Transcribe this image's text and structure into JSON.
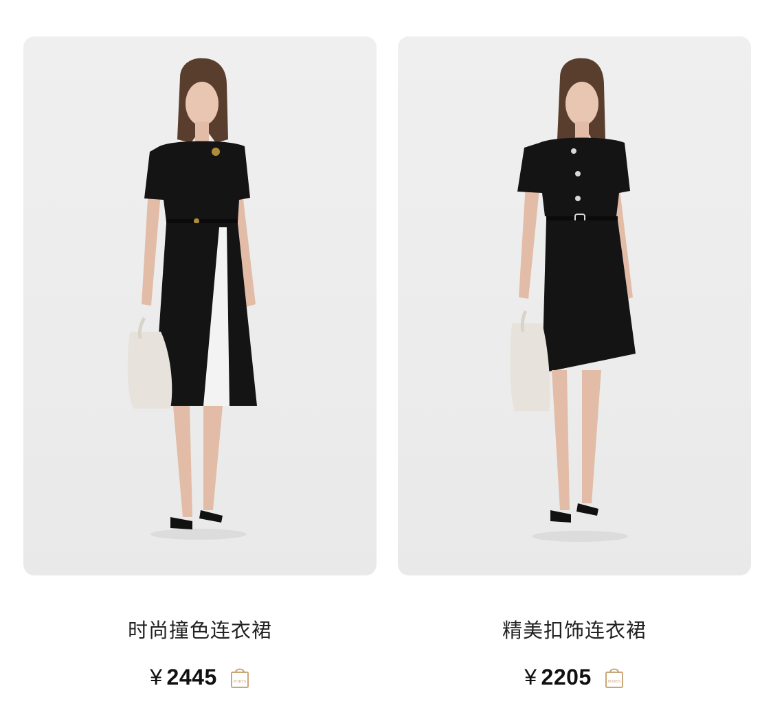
{
  "products": [
    {
      "title": "时尚撞色连衣裙",
      "currency": "¥",
      "price": "2445",
      "bag_icon": "shopping-bag-icon",
      "bag_label": "PORTS"
    },
    {
      "title": "精美扣饰连衣裙",
      "currency": "¥",
      "price": "2205",
      "bag_icon": "shopping-bag-icon",
      "bag_label": "PORTS"
    }
  ],
  "colors": {
    "card_bg": "#ececec",
    "dress": "#141414",
    "bag_accent": "#c9a77a"
  }
}
